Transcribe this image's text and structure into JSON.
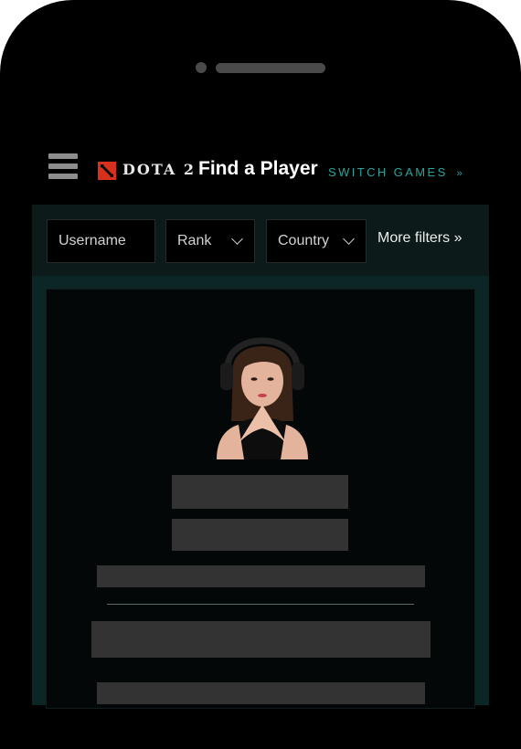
{
  "header": {
    "brand": "DOTA 2",
    "title": "Find a Player",
    "switch_games": "SWITCH GAMES",
    "switch_icon": "double-chevron-down-icon",
    "menu_icon": "hamburger-menu-icon"
  },
  "filters": {
    "username_placeholder": "Username",
    "rank_label": "Rank",
    "country_label": "Country",
    "more_filters": "More filters »"
  },
  "colors": {
    "accent": "#2aa39b",
    "brand_red": "#d7301d",
    "background": "#000000",
    "panel": "#0c2626",
    "placeholder_block": "#333333"
  }
}
